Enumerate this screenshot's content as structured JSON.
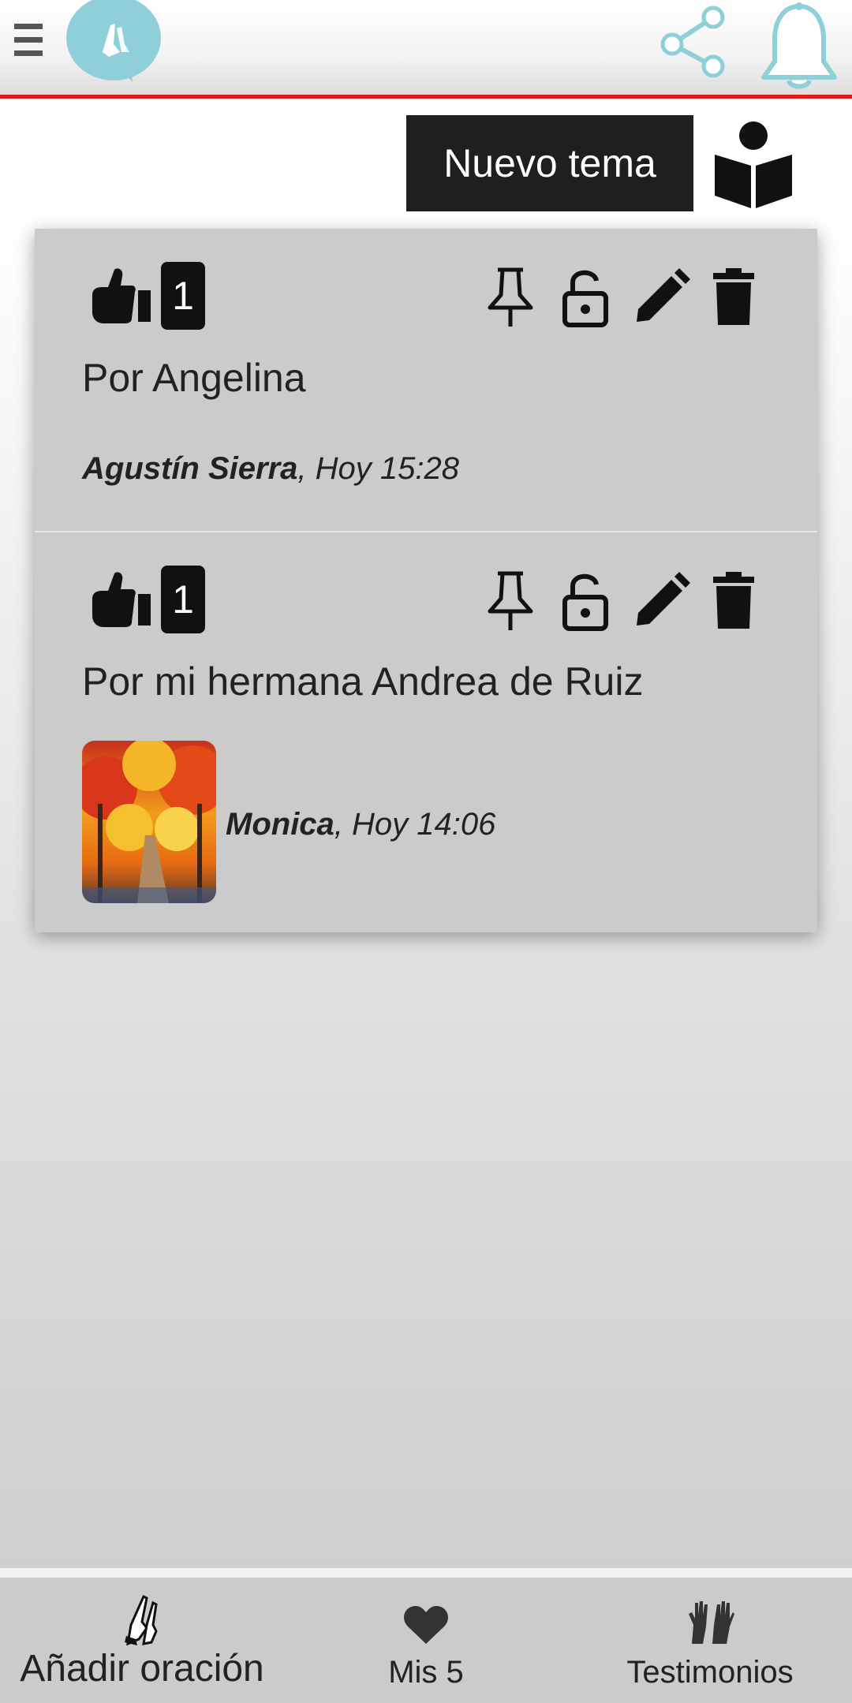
{
  "header": {
    "menu_icon": "hamburger-menu-icon",
    "logo_icon": "praying-hands-speech-bubble-logo",
    "share_icon": "share-icon",
    "bell_icon": "bell-icon",
    "accent_color": "#8fd0d8",
    "divider_color": "#e01b1b"
  },
  "toolbar": {
    "new_topic_label": "Nuevo tema",
    "reader_icon": "person-reading-book-icon"
  },
  "posts": [
    {
      "likes": "1",
      "title": "Por Angelina",
      "author": "Agustín Sierra",
      "time": ", Hoy 15:28",
      "has_image": false
    },
    {
      "likes": "1",
      "title": "Por mi hermana Andrea de Ruiz",
      "author": "Monica",
      "time": ", Hoy 14:06",
      "has_image": true,
      "image_icon": "autumn-forest-path-avatar"
    }
  ],
  "post_actions": [
    "pin-icon",
    "lock-icon",
    "edit-icon",
    "delete-icon"
  ],
  "bottom_nav": {
    "add_label": "Añadir oración",
    "mis5_label": "Mis 5",
    "testimonios_label": "Testimonios"
  }
}
